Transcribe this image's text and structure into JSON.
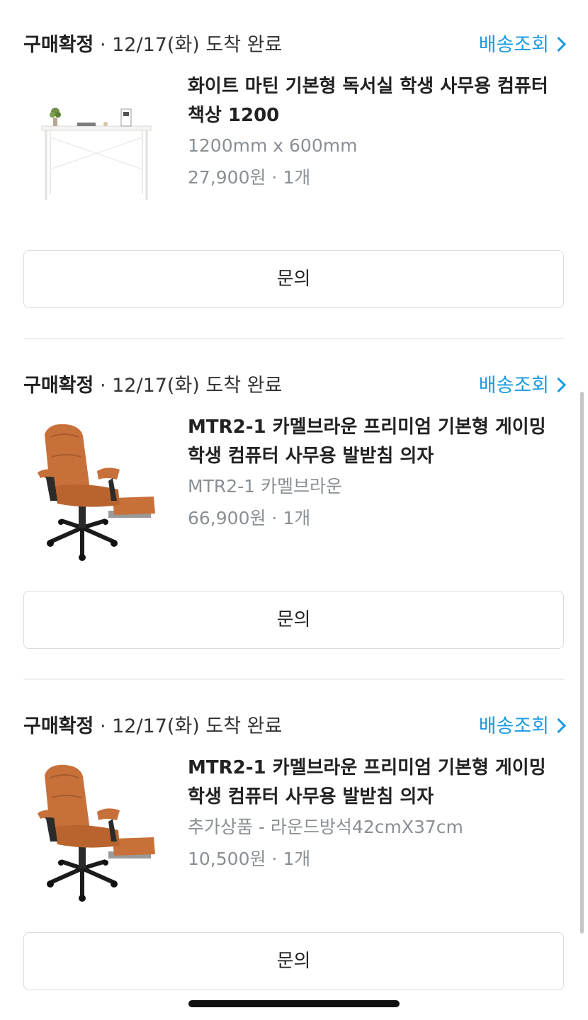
{
  "orders": [
    {
      "status_strong": "구매확정",
      "status_rest": " · 12/17(화) 도착 완료",
      "track_label": "배송조회",
      "product_name": "화이트 마틴 기본형 독서실 학생 사무용 컴퓨터 책상 1200",
      "option": "1200mm x 600mm",
      "price_qty": "27,900원 · 1개",
      "inquiry_label": "문의"
    },
    {
      "status_strong": "구매확정",
      "status_rest": " · 12/17(화) 도착 완료",
      "track_label": "배송조회",
      "product_name": "MTR2-1 카멜브라운 프리미엄 기본형 게이밍 학생 컴퓨터 사무용 발받침 의자",
      "option": "MTR2-1 카멜브라운",
      "price_qty": "66,900원 · 1개",
      "inquiry_label": "문의"
    },
    {
      "status_strong": "구매확정",
      "status_rest": " · 12/17(화) 도착 완료",
      "track_label": "배송조회",
      "product_name": "MTR2-1 카멜브라운 프리미엄 기본형 게이밍 학생 컴퓨터 사무용 발받침 의자",
      "option": "추가상품 - 라운드방석42cmX37cm",
      "price_qty": "10,500원 · 1개",
      "inquiry_label": "문의"
    }
  ],
  "colors": {
    "accent": "#1a9be0",
    "muted_text": "#8a8f95",
    "divider": "#eceef0",
    "chair": "#c8703a"
  }
}
